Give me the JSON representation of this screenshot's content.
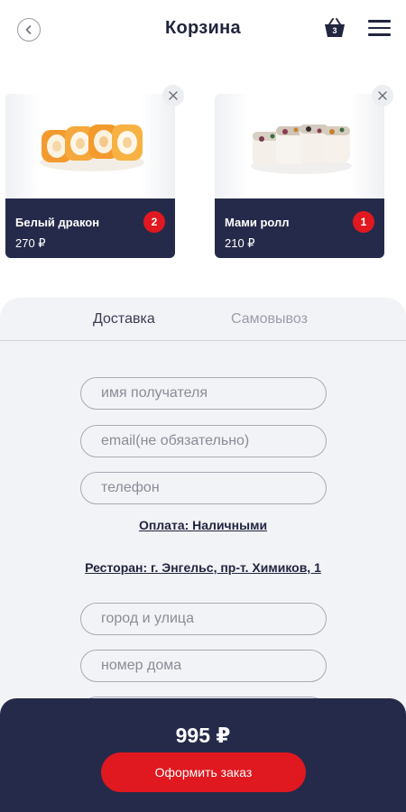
{
  "header": {
    "title": "Корзина",
    "cart_count": "3",
    "back_icon": "chevron-left-icon",
    "cart_icon": "basket-icon",
    "menu_icon": "hamburger-menu-icon"
  },
  "cart_items": [
    {
      "name": "Белый дракон",
      "price": "270 ₽",
      "quantity": "2"
    },
    {
      "name": "Мами ролл",
      "price": "210 ₽",
      "quantity": "1"
    }
  ],
  "tabs": {
    "delivery": "Доставка",
    "pickup": "Самовывоз"
  },
  "form": {
    "recipient_name_placeholder": "имя получателя",
    "email_placeholder": "email(не обязательно)",
    "phone_placeholder": "телефон",
    "payment_link": "Оплата: Наличными",
    "restaurant_link": "Ресторан: г. Энгельс, пр-т. Химиков, 1",
    "street_placeholder": "город и улица",
    "house_placeholder": "номер дома"
  },
  "footer": {
    "total": "995 ₽",
    "checkout_label": "Оформить заказ"
  },
  "colors": {
    "navy": "#262a4a",
    "accent_red": "#e0181f",
    "panel_bg": "#f2f3f6"
  }
}
